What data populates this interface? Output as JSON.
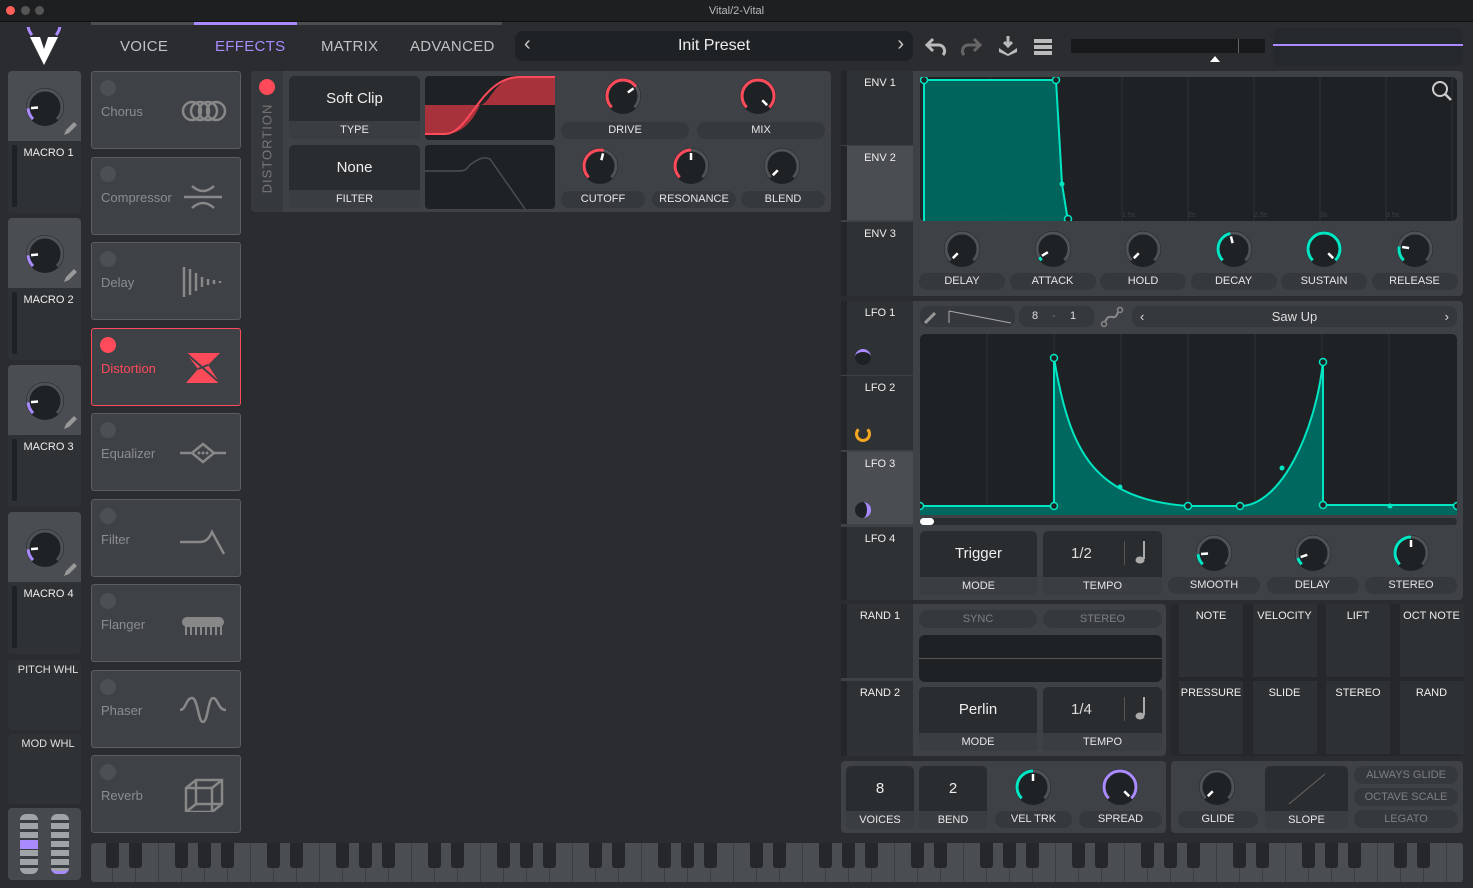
{
  "window": {
    "title": "Vital/2-Vital"
  },
  "nav": {
    "tabs": [
      {
        "label": "VOICE"
      },
      {
        "label": "EFFECTS"
      },
      {
        "label": "MATRIX"
      },
      {
        "label": "ADVANCED"
      }
    ],
    "active": "EFFECTS"
  },
  "preset": {
    "name": "Init Preset",
    "prev": "‹",
    "next": "›"
  },
  "colors": {
    "accent": "#a98bff",
    "modulation": "#00e6c3",
    "distortion": "#ff4a5a",
    "lfo2": "#f5a623"
  },
  "macros": [
    {
      "label": "MACRO 1",
      "value": 0.15
    },
    {
      "label": "MACRO 2",
      "value": 0.15
    },
    {
      "label": "MACRO 3",
      "value": 0.15
    },
    {
      "label": "MACRO 4",
      "value": 0.15
    }
  ],
  "wheels": {
    "pitch_label": "PITCH WHL",
    "mod_label": "MOD WHL",
    "pitch_value": 0.5,
    "mod_value": 0
  },
  "effects": [
    {
      "name": "Chorus",
      "icon": "chorus-icon",
      "enabled": false
    },
    {
      "name": "Compressor",
      "icon": "compressor-icon",
      "enabled": false
    },
    {
      "name": "Delay",
      "icon": "delay-icon",
      "enabled": false
    },
    {
      "name": "Distortion",
      "icon": "distortion-icon",
      "enabled": true
    },
    {
      "name": "Equalizer",
      "icon": "equalizer-icon",
      "enabled": false
    },
    {
      "name": "Filter",
      "icon": "filter-icon",
      "enabled": false
    },
    {
      "name": "Flanger",
      "icon": "flanger-icon",
      "enabled": false
    },
    {
      "name": "Phaser",
      "icon": "phaser-icon",
      "enabled": false
    },
    {
      "name": "Reverb",
      "icon": "reverb-icon",
      "enabled": false
    }
  ],
  "distortion": {
    "title": "DISTORTION",
    "type": {
      "value": "Soft Clip",
      "label": "TYPE"
    },
    "filter": {
      "value": "None",
      "label": "FILTER"
    },
    "knobs": {
      "drive": {
        "label": "DRIVE",
        "value": 0.7,
        "color": "#ff4a5a"
      },
      "mix": {
        "label": "MIX",
        "value": 1.0,
        "color": "#ff4a5a"
      },
      "cutoff": {
        "label": "CUTOFF",
        "value": 0.55,
        "color": "#ff4a5a"
      },
      "resonance": {
        "label": "RESONANCE",
        "value": 0.5,
        "color": "#ff4a5a"
      },
      "blend": {
        "label": "BLEND",
        "value": 0.0,
        "color": "#ff4a5a"
      }
    }
  },
  "envelopes": {
    "tabs": [
      {
        "label": "ENV 1"
      },
      {
        "label": "ENV 2"
      },
      {
        "label": "ENV 3"
      }
    ],
    "selected": "ENV 2",
    "time_ticks": [
      "500ms",
      "1s",
      "1.5s",
      "2s",
      "2.5s",
      "3s",
      "3.5s"
    ],
    "knobs": [
      {
        "label": "DELAY",
        "value": 0.0,
        "color": "#00e6c3"
      },
      {
        "label": "ATTACK",
        "value": 0.05,
        "color": "#00e6c3"
      },
      {
        "label": "HOLD",
        "value": 0.0,
        "color": "#00e6c3"
      },
      {
        "label": "DECAY",
        "value": 0.45,
        "color": "#00e6c3"
      },
      {
        "label": "SUSTAIN",
        "value": 1.0,
        "color": "#00e6c3"
      },
      {
        "label": "RELEASE",
        "value": 0.2,
        "color": "#00e6c3"
      }
    ]
  },
  "lfos": {
    "tabs": [
      {
        "label": "LFO 1"
      },
      {
        "label": "LFO 2"
      },
      {
        "label": "LFO 3"
      },
      {
        "label": "LFO 4"
      }
    ],
    "selected": "LFO 3",
    "grid_x": "8",
    "grid_y": "1",
    "grid_sep": "-",
    "shape": "Saw Up",
    "mode": {
      "value": "Trigger",
      "label": "MODE"
    },
    "tempo": {
      "value": "1/2",
      "label": "TEMPO"
    },
    "knobs": [
      {
        "label": "SMOOTH",
        "value": 0.15,
        "color": "#00e6c3"
      },
      {
        "label": "DELAY",
        "value": 0.1,
        "color": "#00e6c3"
      },
      {
        "label": "STEREO",
        "value": 0.5,
        "color": "#00e6c3"
      }
    ]
  },
  "randoms": {
    "tabs": [
      {
        "label": "RAND 1"
      },
      {
        "label": "RAND 2"
      }
    ],
    "sync_label": "SYNC",
    "stereo_label": "STEREO",
    "mode": {
      "value": "Perlin",
      "label": "MODE"
    },
    "tempo": {
      "value": "1/4",
      "label": "TEMPO"
    }
  },
  "mod_sources": [
    {
      "label": "NOTE"
    },
    {
      "label": "VELOCITY"
    },
    {
      "label": "LIFT"
    },
    {
      "label": "OCT NOTE"
    },
    {
      "label": "PRESSURE"
    },
    {
      "label": "SLIDE"
    },
    {
      "label": "STEREO"
    },
    {
      "label": "RAND"
    }
  ],
  "voice": {
    "voices": {
      "value": "8",
      "label": "VOICES"
    },
    "bend": {
      "value": "2",
      "label": "BEND"
    },
    "vel_trk": {
      "label": "VEL TRK",
      "value": 0.5,
      "color": "#00e6c3"
    },
    "spread": {
      "label": "SPREAD",
      "value": 1.0,
      "color": "#a98bff"
    }
  },
  "glide": {
    "glide": {
      "label": "GLIDE",
      "value": 0.0,
      "color": "#00e6c3"
    },
    "slope_label": "SLOPE",
    "toggles": [
      {
        "label": "ALWAYS GLIDE"
      },
      {
        "label": "OCTAVE SCALE"
      },
      {
        "label": "LEGATO"
      }
    ]
  }
}
